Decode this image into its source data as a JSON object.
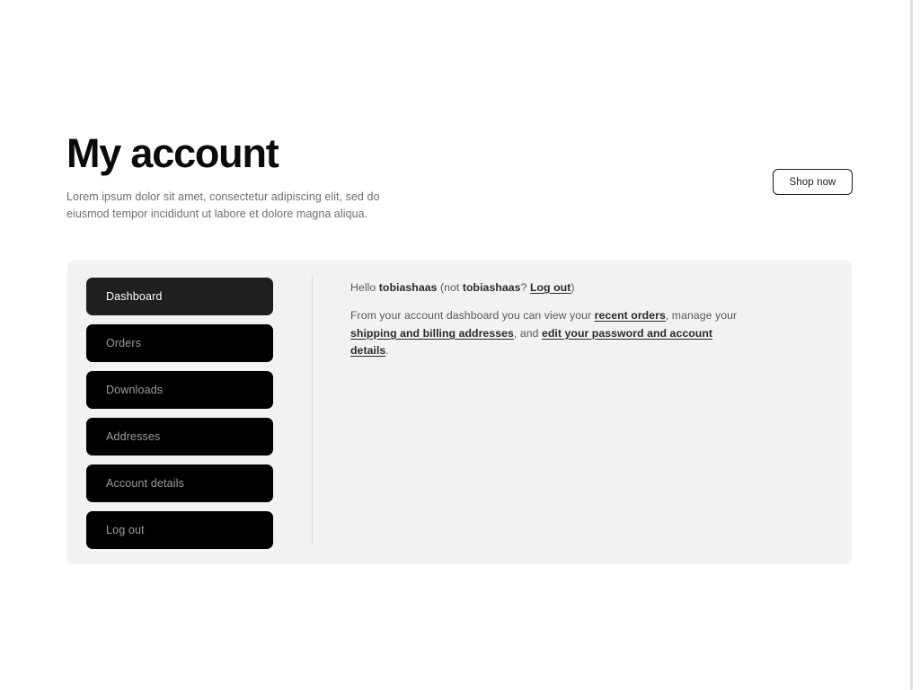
{
  "header": {
    "title": "My account",
    "subtitle": "Lorem ipsum dolor sit amet, consectetur adipiscing elit, sed do eiusmod tempor incididunt ut labore et dolore magna aliqua.",
    "shop_now_label": "Shop now"
  },
  "account_nav": {
    "items": [
      {
        "label": "Dashboard",
        "active": true
      },
      {
        "label": "Orders",
        "active": false
      },
      {
        "label": "Downloads",
        "active": false
      },
      {
        "label": "Addresses",
        "active": false
      },
      {
        "label": "Account details",
        "active": false
      },
      {
        "label": "Log out",
        "active": false
      }
    ]
  },
  "account_content": {
    "greeting": {
      "hello_prefix": "Hello ",
      "user_name": "tobiashaas",
      "not_prefix": " (not ",
      "not_user_name": "tobiashaas",
      "question_mark": "? ",
      "logout_link": "Log out",
      "closing_paren": ")"
    },
    "blurb": {
      "part1": "From your account dashboard you can view your ",
      "link_recent_orders": "recent orders",
      "part2": ", manage your ",
      "link_addresses": "shipping and billing addresses",
      "part3": ", and ",
      "link_account_details": "edit your password and account details",
      "part4": "."
    }
  },
  "colors": {
    "page_background": "#ffffff",
    "panel_background": "#f2f2f2",
    "nav_item_background": "#000000",
    "nav_item_active_background": "#1f1f1f",
    "nav_item_text": "#9d9d9d",
    "nav_item_active_text": "#ffffff",
    "heading_text": "#0b0b0b",
    "body_text": "#5a5a5a",
    "subtitle_text": "#6e6e6e",
    "divider": "#dcdcdc",
    "scrollbar": "#e0e0e0"
  }
}
